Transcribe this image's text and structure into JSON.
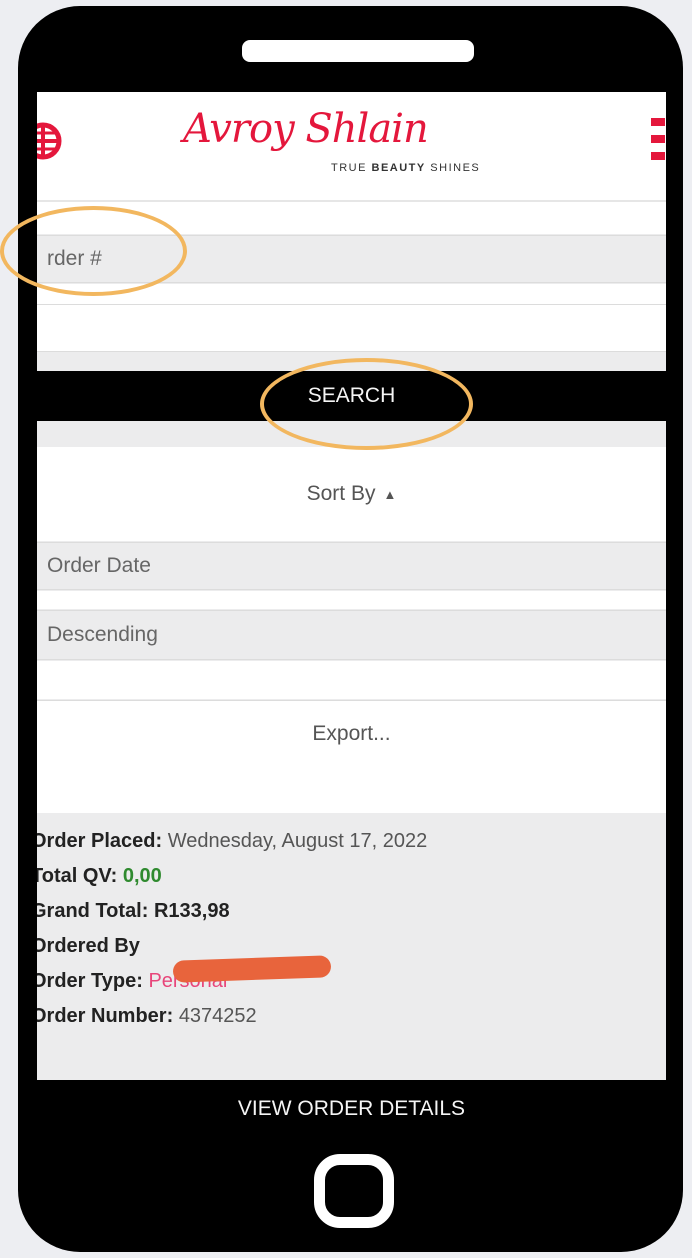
{
  "header": {
    "brand": "Avroy Shlain",
    "tagline_prefix": "TRUE ",
    "tagline_bold": "BEAUTY",
    "tagline_suffix": " SHINES"
  },
  "search": {
    "order_placeholder": "rder #",
    "button_label": "SEARCH"
  },
  "sort": {
    "label": "Sort By",
    "caret": "▲",
    "field_value": "Order Date",
    "direction_value": "Descending"
  },
  "export_label": "Export...",
  "order": {
    "placed_label": "Order Placed:",
    "placed_value": "Wednesday, August 17, 2022",
    "qv_label": "Total QV:",
    "qv_value": "0,00",
    "grand_label": "Grand Total:",
    "grand_value": "R133,98",
    "ordered_by_label": "Ordered By",
    "type_label": "Order Type:",
    "type_value": "Personal",
    "number_label": "Order Number:",
    "number_value": "4374252",
    "view_button": "VIEW ORDER DETAILS"
  },
  "colors": {
    "brand_red": "#e4173c",
    "highlight_orange": "#f2b75f",
    "redaction": "#e8643c",
    "qv_green": "#2f8a2f",
    "type_pink": "#e8467a"
  },
  "icons": [
    "globe-icon",
    "hamburger-menu-icon",
    "sort-caret-up-icon"
  ]
}
